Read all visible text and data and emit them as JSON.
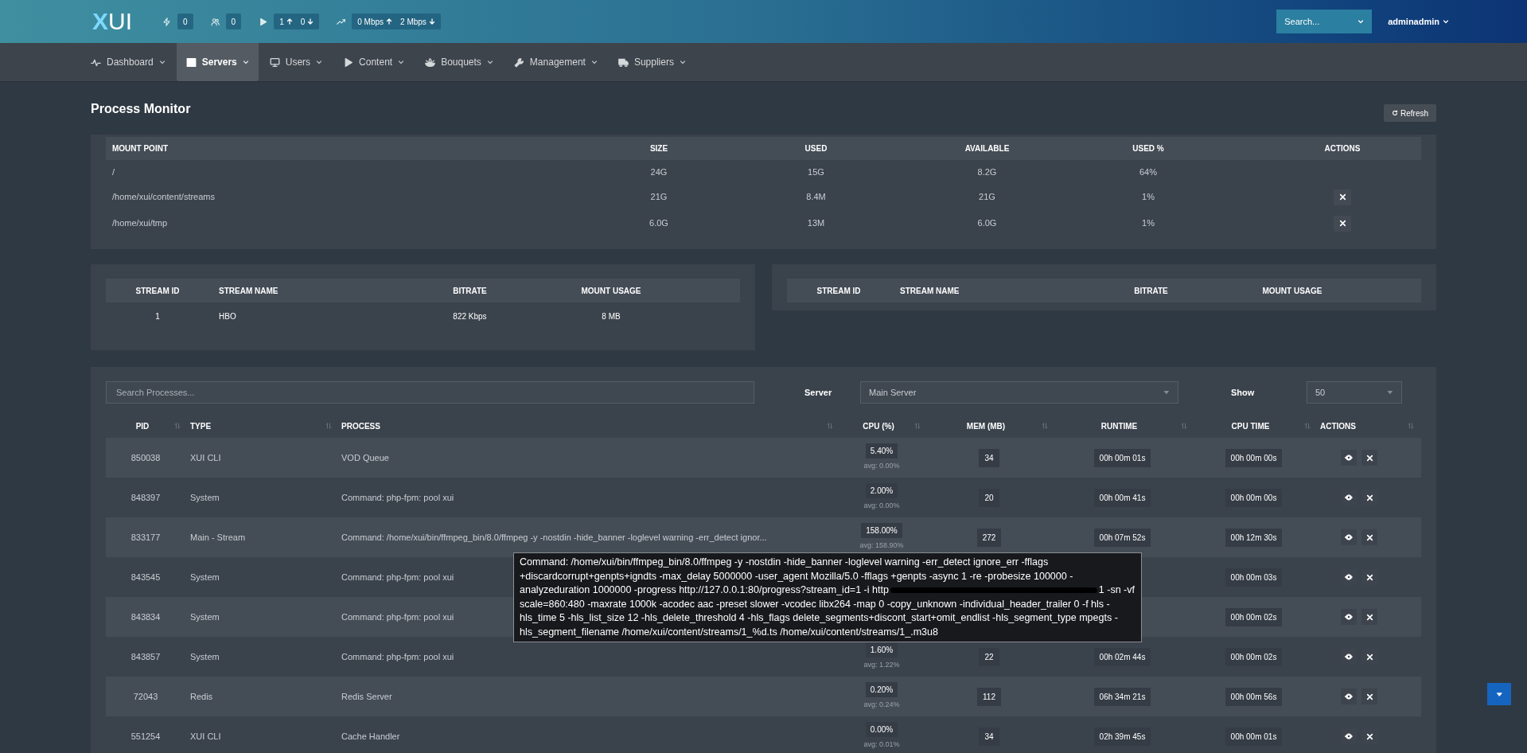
{
  "header": {
    "logo": {
      "mark": "X",
      "text": "UI"
    },
    "stats": [
      {
        "kind": "single",
        "value": "0"
      },
      {
        "kind": "single",
        "value": "0"
      },
      {
        "kind": "updown",
        "up": "1",
        "down": "0"
      },
      {
        "kind": "updown",
        "up": "0 Mbps",
        "down": "2 Mbps"
      }
    ],
    "search": {
      "placeholder": "Search..."
    },
    "user": "adminadmin"
  },
  "nav": [
    {
      "label": "Dashboard",
      "selected": false
    },
    {
      "label": "Servers",
      "selected": true
    },
    {
      "label": "Users",
      "selected": false
    },
    {
      "label": "Content",
      "selected": false
    },
    {
      "label": "Bouquets",
      "selected": false
    },
    {
      "label": "Management",
      "selected": false
    },
    {
      "label": "Suppliers",
      "selected": false
    }
  ],
  "page": {
    "title": "Process Monitor",
    "refresh": "Refresh"
  },
  "mounts": {
    "columns": [
      "MOUNT POINT",
      "SIZE",
      "USED",
      "AVAILABLE",
      "USED %",
      "ACTIONS"
    ],
    "rows": [
      {
        "mount": "/",
        "size": "24G",
        "used": "15G",
        "available": "8.2G",
        "used_pct": "64%",
        "removable": false
      },
      {
        "mount": "/home/xui/content/streams",
        "size": "21G",
        "used": "8.4M",
        "available": "21G",
        "used_pct": "1%",
        "removable": true
      },
      {
        "mount": "/home/xui/tmp",
        "size": "6.0G",
        "used": "13M",
        "available": "6.0G",
        "used_pct": "1%",
        "removable": true
      }
    ]
  },
  "stream_tables": [
    {
      "columns": [
        "STREAM ID",
        "STREAM NAME",
        "BITRATE",
        "MOUNT USAGE"
      ],
      "rows": [
        [
          "1",
          "HBO",
          "822 Kbps",
          "8 MB"
        ]
      ]
    },
    {
      "columns": [
        "STREAM ID",
        "STREAM NAME",
        "BITRATE",
        "MOUNT USAGE"
      ]
    }
  ],
  "processes": {
    "search_placeholder": "Search Processes...",
    "server_label": "Server",
    "server_value": "Main Server",
    "show_label": "Show",
    "show_value": "50",
    "columns": [
      "PID",
      "TYPE",
      "PROCESS",
      "CPU (%)",
      "MEM (MB)",
      "RUNTIME",
      "CPU TIME",
      "ACTIONS"
    ],
    "rows": [
      {
        "pid": "850038",
        "type": "XUI CLI",
        "process": "VOD Queue",
        "cpu": "5.40%",
        "cpu_avg": "avg: 0.00%",
        "mem": "34",
        "runtime": "00h 00m 01s",
        "cpu_time": "00h 00m 00s"
      },
      {
        "pid": "848397",
        "type": "System",
        "process": "Command: php-fpm: pool xui",
        "cpu": "2.00%",
        "cpu_avg": "avg: 0.00%",
        "mem": "20",
        "runtime": "00h 00m 41s",
        "cpu_time": "00h 00m 00s"
      },
      {
        "pid": "833177",
        "type": "Main - Stream",
        "process": "Command: /home/xui/bin/ffmpeg_bin/8.0/ffmpeg -y -nostdin -hide_banner -loglevel warning -err_detect ignor...",
        "cpu": "158.00%",
        "cpu_avg": "avg: 158.90%",
        "mem": "272",
        "runtime": "00h 07m 52s",
        "cpu_time": "00h 12m 30s"
      },
      {
        "pid": "843545",
        "type": "System",
        "process": "Command: php-fpm: pool xui",
        "cpu_time": "00h 00m 03s"
      },
      {
        "pid": "843834",
        "type": "System",
        "process": "Command: php-fpm: pool xui",
        "cpu_time": "00h 00m 02s"
      },
      {
        "pid": "843857",
        "type": "System",
        "process": "Command: php-fpm: pool xui",
        "cpu": "1.60%",
        "cpu_avg": "avg: 1.22%",
        "mem": "22",
        "runtime": "00h 02m 44s",
        "cpu_time": "00h 00m 02s"
      },
      {
        "pid": "72043",
        "type": "Redis",
        "process": "Redis Server",
        "cpu": "0.20%",
        "cpu_avg": "avg: 0.24%",
        "mem": "112",
        "runtime": "06h 34m 21s",
        "cpu_time": "00h 00m 56s"
      },
      {
        "pid": "551254",
        "type": "XUI CLI",
        "process": "Cache Handler",
        "cpu": "0.00%",
        "cpu_avg": "avg: 0.01%",
        "mem": "34",
        "runtime": "02h 39m 45s",
        "cpu_time": "00h 00m 01s"
      }
    ],
    "tooltip": {
      "before": "Command: /home/xui/bin/ffmpeg_bin/8.0/ffmpeg -y -nostdin -hide_banner -loglevel warning -err_detect ignore_err -fflags +discardcorrupt+genpts+igndts -max_delay 5000000 -user_agent Mozilla/5.0 -fflags +genpts -async 1 -re -probesize 100000 -analyzeduration 1000000 -progress http://127.0.0.1:80/progress?stream_id=1 -i http",
      "after": "1 -sn -vf scale=860:480 -maxrate 1000k -acodec aac -preset slower -vcodec libx264 -map 0 -copy_unknown -individual_header_trailer 0 -f hls -hls_time 5 -hls_list_size 12 -hls_delete_threshold 4 -hls_flags delete_segments+discont_start+omit_endlist -hls_segment_type mpegts -hls_segment_filename /home/xui/content/streams/1_%d.ts /home/xui/content/streams/1_.m3u8"
    }
  }
}
